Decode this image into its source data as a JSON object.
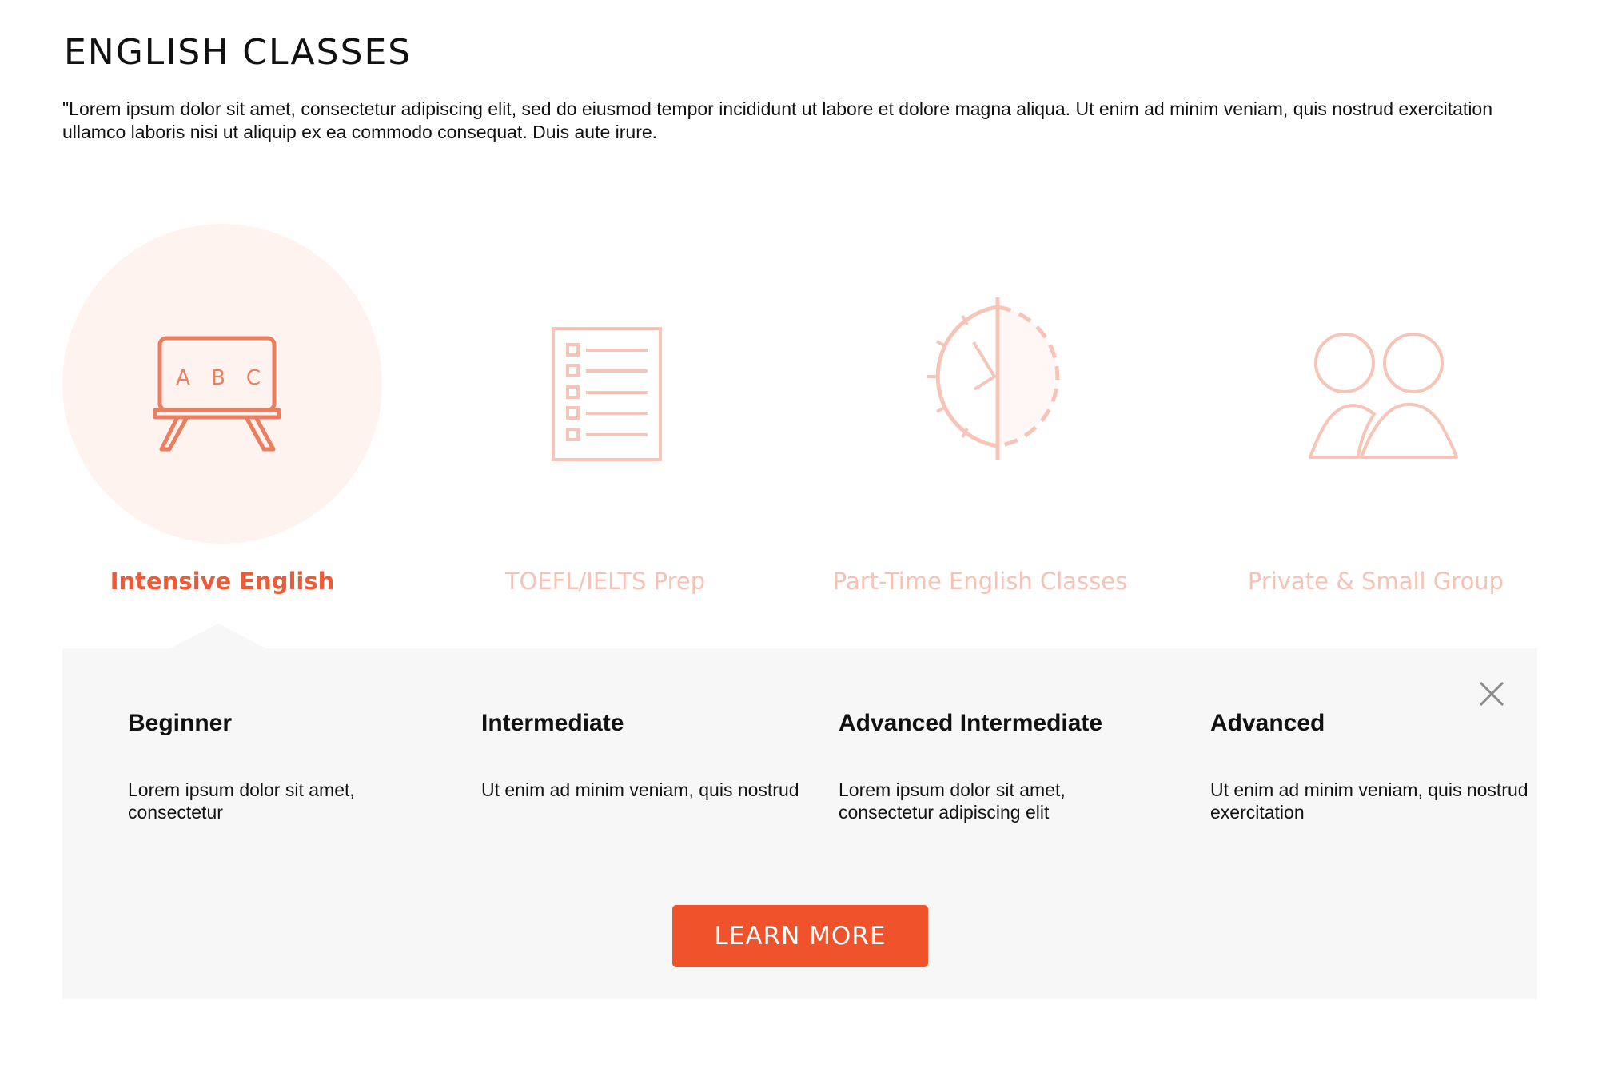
{
  "header": {
    "title": "ENGLISH CLASSES",
    "intro": "\"Lorem ipsum dolor sit amet, consectetur adipiscing elit, sed do eiusmod tempor incididunt ut labore et dolore magna aliqua. Ut enim ad minim veniam, quis nostrud exercitation ullamco laboris nisi ut aliquip ex ea commodo consequat. Duis aute irure."
  },
  "tabs": [
    {
      "label": "Intensive English",
      "icon": "chalkboard-abc-icon",
      "active": true
    },
    {
      "label": "TOEFL/IELTS Prep",
      "icon": "checklist-icon",
      "active": false
    },
    {
      "label": "Part-Time English Classes",
      "icon": "half-clock-icon",
      "active": false
    },
    {
      "label": "Private & Small Group",
      "icon": "two-people-icon",
      "active": false
    }
  ],
  "board_letters": [
    "A",
    "B",
    "C"
  ],
  "panel": {
    "levels": [
      {
        "title": "Beginner",
        "description": "Lorem ipsum dolor sit amet, consectetur"
      },
      {
        "title": "Intermediate",
        "description": "Ut enim ad minim veniam, quis nostrud"
      },
      {
        "title": "Advanced Intermediate",
        "description": "Lorem ipsum dolor sit amet, consectetur adipiscing elit"
      },
      {
        "title": "Advanced",
        "description": "Ut enim ad minim veniam, quis nostrud exercitation"
      }
    ],
    "close_icon": "close-icon",
    "cta_label": "LEARN MORE"
  },
  "colors": {
    "accent": "#f0532b",
    "active_text": "#ec5a36",
    "inactive": "#f7c2b4",
    "active_circle": "#fff3f0",
    "panel_bg": "#f7f7f7"
  }
}
